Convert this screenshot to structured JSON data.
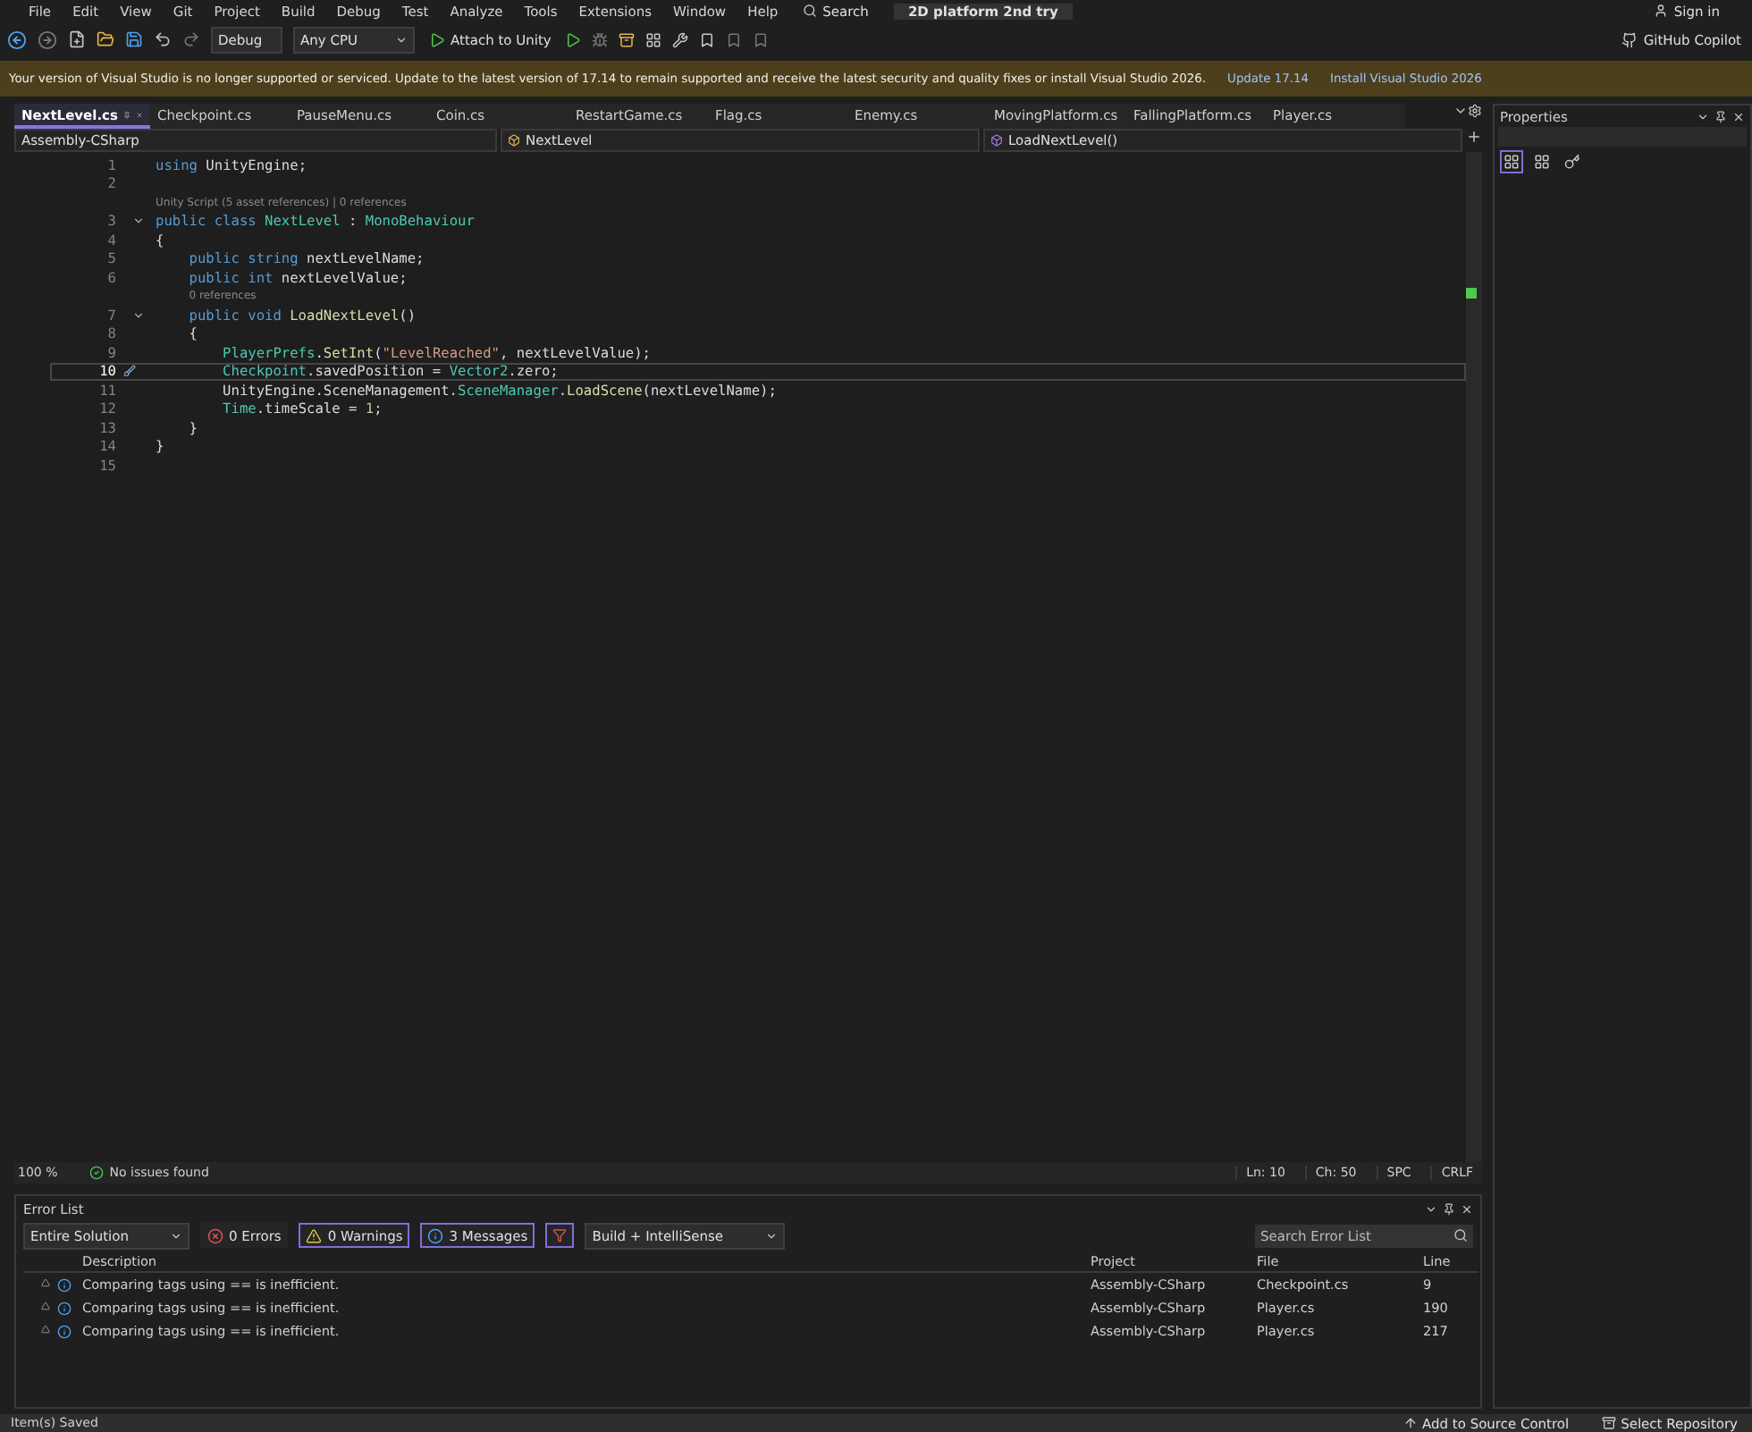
{
  "menu": {
    "items": [
      "File",
      "Edit",
      "View",
      "Git",
      "Project",
      "Build",
      "Debug",
      "Test",
      "Analyze",
      "Tools",
      "Extensions",
      "Window",
      "Help"
    ],
    "search": "Search",
    "solution": "2D platform 2nd try",
    "sign_in": "Sign in"
  },
  "toolbar": {
    "configuration": "Debug",
    "platform": "Any CPU",
    "run": "Attach to Unity",
    "copilot": "GitHub Copilot"
  },
  "notice": {
    "text": "Your version of Visual Studio is no longer supported or serviced. Update to the latest version of 17.14 to remain supported and receive the latest security and quality fixes or install Visual Studio 2026.",
    "links": [
      "Update 17.14",
      "Install Visual Studio 2026"
    ]
  },
  "tabs": [
    {
      "label": "NextLevel.cs",
      "selected": true
    },
    {
      "label": "Checkpoint.cs",
      "selected": false
    },
    {
      "label": "PauseMenu.cs",
      "selected": false
    },
    {
      "label": "Coin.cs",
      "selected": false
    },
    {
      "label": "RestartGame.cs",
      "selected": false
    },
    {
      "label": "Flag.cs",
      "selected": false
    },
    {
      "label": "Enemy.cs",
      "selected": false
    },
    {
      "label": "MovingPlatform.cs",
      "selected": false
    },
    {
      "label": "FallingPlatform.cs",
      "selected": false
    },
    {
      "label": "Player.cs",
      "selected": false
    }
  ],
  "navigation": {
    "project": "Assembly-CSharp",
    "type": "NextLevel",
    "member": "LoadNextLevel()"
  },
  "code": [
    {
      "kind": "line",
      "number": "1",
      "current": false,
      "tokens": [
        {
          "kind": "keyword",
          "text": "using"
        },
        {
          "kind": "plain",
          "text": " UnityEngine;"
        }
      ]
    },
    {
      "kind": "line",
      "number": "2",
      "current": false
    },
    {
      "kind": "codelens",
      "text": "Unity Script (5 asset references) | 0 references"
    },
    {
      "kind": "line",
      "number": "3",
      "current": false,
      "fold": true,
      "tokens": [
        {
          "kind": "keyword",
          "text": "public class"
        },
        {
          "kind": "type",
          "text": " NextLevel"
        },
        {
          "kind": "plain",
          "text": " : "
        },
        {
          "kind": "type",
          "text": "MonoBehaviour"
        }
      ]
    },
    {
      "kind": "line",
      "number": "4",
      "current": false,
      "tokens": [
        {
          "kind": "plain",
          "text": "{"
        }
      ]
    },
    {
      "kind": "line",
      "number": "5",
      "current": false,
      "tokens": [
        {
          "kind": "keyword",
          "text": "    public string"
        },
        {
          "kind": "plain",
          "text": " nextLevelName;"
        }
      ]
    },
    {
      "kind": "line",
      "number": "6",
      "current": false,
      "tokens": [
        {
          "kind": "keyword",
          "text": "    public int"
        },
        {
          "kind": "plain",
          "text": " nextLevelValue;"
        }
      ]
    },
    {
      "kind": "codelens",
      "text": "0 references"
    },
    {
      "kind": "line",
      "number": "7",
      "current": false,
      "fold": true,
      "tokens": [
        {
          "kind": "keyword",
          "text": "    public void"
        },
        {
          "kind": "method",
          "text": " LoadNextLevel"
        },
        {
          "kind": "plain",
          "text": "()"
        }
      ]
    },
    {
      "kind": "line",
      "number": "8",
      "current": false,
      "tokens": [
        {
          "kind": "plain",
          "text": "    {"
        }
      ]
    },
    {
      "kind": "line",
      "number": "9",
      "current": false,
      "tokens": [
        {
          "kind": "type",
          "text": "        PlayerPrefs"
        },
        {
          "kind": "plain",
          "text": "."
        },
        {
          "kind": "method",
          "text": "SetInt"
        },
        {
          "kind": "plain",
          "text": "("
        },
        {
          "kind": "string",
          "text": "\"LevelReached\""
        },
        {
          "kind": "plain",
          "text": ", nextLevelValue);"
        }
      ]
    },
    {
      "kind": "line",
      "number": "10",
      "current": true,
      "tokens": [
        {
          "kind": "type",
          "text": "        Checkpoint"
        },
        {
          "kind": "plain",
          "text": ".savedPosition = "
        },
        {
          "kind": "type",
          "text": "Vector2"
        },
        {
          "kind": "plain",
          "text": ".zero;"
        }
      ]
    },
    {
      "kind": "line",
      "number": "11",
      "current": false,
      "tokens": [
        {
          "kind": "plain",
          "text": "        UnityEngine.SceneManagement."
        },
        {
          "kind": "type",
          "text": "SceneManager"
        },
        {
          "kind": "plain",
          "text": "."
        },
        {
          "kind": "method",
          "text": "LoadScene"
        },
        {
          "kind": "plain",
          "text": "(nextLevelName);"
        }
      ]
    },
    {
      "kind": "line",
      "number": "12",
      "current": false,
      "tokens": [
        {
          "kind": "type",
          "text": "        Time"
        },
        {
          "kind": "plain",
          "text": ".timeScale = "
        },
        {
          "kind": "number",
          "text": "1"
        },
        {
          "kind": "plain",
          "text": ";"
        }
      ]
    },
    {
      "kind": "line",
      "number": "13",
      "current": false,
      "tokens": [
        {
          "kind": "plain",
          "text": "    }"
        }
      ]
    },
    {
      "kind": "line",
      "number": "14",
      "current": false,
      "tokens": [
        {
          "kind": "plain",
          "text": "}"
        }
      ]
    },
    {
      "kind": "line",
      "number": "15",
      "current": false
    }
  ],
  "editor_status": {
    "zoom": "100 %",
    "issues": "No issues found",
    "line": "Ln: 10",
    "column": "Ch: 50",
    "indent": "SPC",
    "line_ending": "CRLF"
  },
  "error_list": {
    "title": "Error List",
    "scope": "Entire Solution",
    "filters": [
      {
        "kind": "error",
        "label": "0 Errors",
        "selected": false
      },
      {
        "kind": "warning",
        "label": "0 Warnings",
        "selected": true
      },
      {
        "kind": "message",
        "label": "3 Messages",
        "selected": true
      }
    ],
    "source": "Build + IntelliSense",
    "search": {
      "placeholder": "Search Error List"
    },
    "columns": [
      "Description",
      "Project",
      "File",
      "Line"
    ],
    "rows": [
      {
        "description": "Comparing tags using == is inefficient.",
        "project": "Assembly-CSharp",
        "file": "Checkpoint.cs",
        "line": "9"
      },
      {
        "description": "Comparing tags using == is inefficient.",
        "project": "Assembly-CSharp",
        "file": "Player.cs",
        "line": "190"
      },
      {
        "description": "Comparing tags using == is inefficient.",
        "project": "Assembly-CSharp",
        "file": "Player.cs",
        "line": "217"
      }
    ]
  },
  "properties": {
    "title": "Properties"
  },
  "status_bar": {
    "message": "Item(s) Saved",
    "source_control": "Add to Source Control",
    "repository": "Select Repository"
  }
}
